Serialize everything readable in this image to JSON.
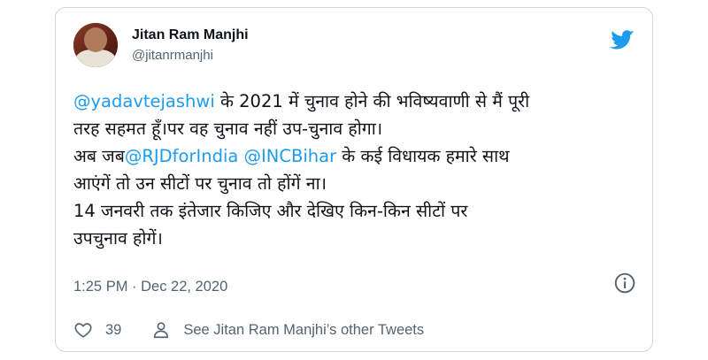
{
  "author": {
    "name": "Jitan Ram Manjhi",
    "handle": "@jitanrmanjhi"
  },
  "tweet": {
    "lines": [
      [
        {
          "text": "@yadavtejashwi",
          "mention": true
        },
        {
          "text": " के 2021 में चुनाव होने की भविष्यवाणी से मैं पूरी",
          "mention": false
        }
      ],
      [
        {
          "text": "तरह सहमत हूँ।पर वह चुनाव नहीं उप-चुनाव होगा।",
          "mention": false
        }
      ],
      [
        {
          "text": "अब जब",
          "mention": false
        },
        {
          "text": "@RJDforIndia",
          "mention": true
        },
        {
          "text": " ",
          "mention": false
        },
        {
          "text": "@INCBihar",
          "mention": true
        },
        {
          "text": " के कई विधायक हमारे साथ",
          "mention": false
        }
      ],
      [
        {
          "text": "आएंगें तो उन सीटों पर चुनाव तो होंगें ना।",
          "mention": false
        }
      ],
      [
        {
          "text": "14 जनवरी तक इंतेजार किजिए और देखिए किन-किन सीटों पर",
          "mention": false
        }
      ],
      [
        {
          "text": "उपचुनाव होगें।",
          "mention": false
        }
      ]
    ]
  },
  "meta": {
    "timestamp": "1:25 PM · Dec 22, 2020"
  },
  "actions": {
    "like_count": "39",
    "see_more_label": "See Jitan Ram Manjhi’s other Tweets"
  },
  "icons": {
    "brand": "twitter-bird-icon",
    "info": "info-icon",
    "like": "heart-icon",
    "profile": "person-icon"
  },
  "colors": {
    "brand": "#1d9bf0",
    "mention": "#1d9bf0",
    "secondary_text": "#536471",
    "border": "#cfd9de"
  }
}
